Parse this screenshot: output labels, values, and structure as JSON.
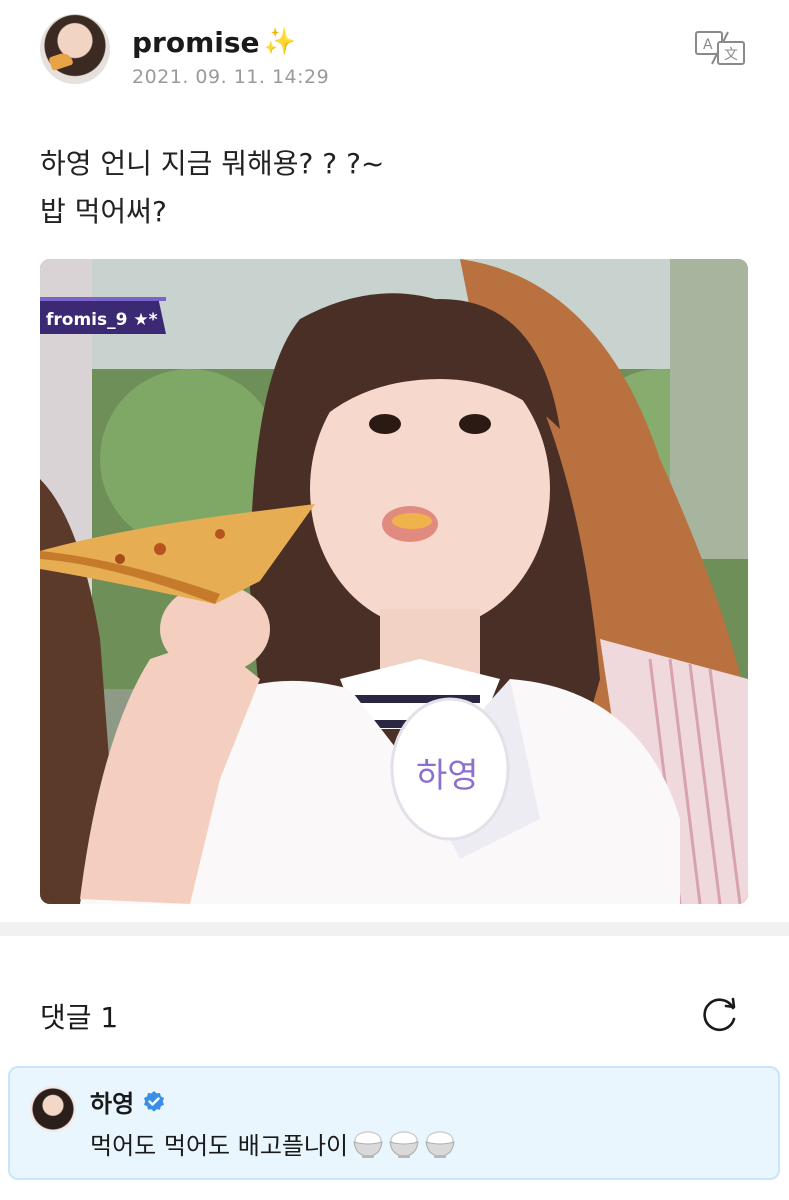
{
  "post": {
    "username": "promise",
    "username_emoji": "sparkles-icon",
    "timestamp": "2021. 09. 11. 14:29",
    "text_lines": [
      "하영 언니 지금 뭐해용? ? ?~",
      "밥 먹어써?"
    ],
    "photo": {
      "description_icon": "photo-girl-eating-pizza",
      "overlay_tag": "fromis_9 ★*",
      "name_badge": "하영"
    }
  },
  "comments": {
    "title": "댓글 1",
    "items": [
      {
        "author": "하영",
        "verified": true,
        "text": "먹어도 먹어도 배고플나이",
        "emojis": [
          "rice-bowl-icon",
          "rice-bowl-icon",
          "rice-bowl-icon"
        ]
      }
    ]
  },
  "colors": {
    "accent_blue": "#3a8ee6",
    "comment_bg": "#eaf6fd",
    "timestamp_gray": "#9a9a9a",
    "tag_purple": "#3b2a73"
  }
}
